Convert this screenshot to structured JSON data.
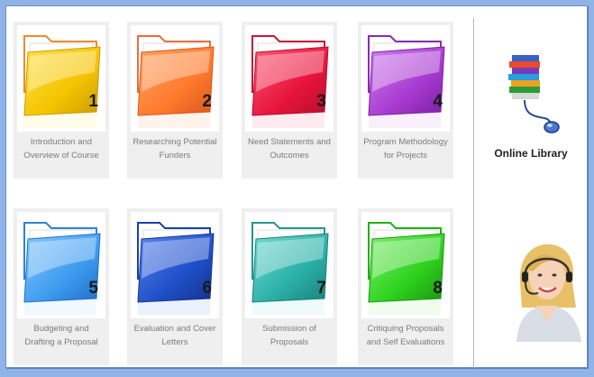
{
  "modules": [
    {
      "number": "1",
      "line1": "Introduction and",
      "line2": "Overview of Course",
      "color": "#f5c400",
      "light": "#ffe34d",
      "dark": "#c99a00",
      "tab": "#f08a2c"
    },
    {
      "number": "2",
      "line1": "Researching Potential",
      "line2": "Funders",
      "color": "#ff7a2e",
      "light": "#ffa565",
      "dark": "#d9561a",
      "tab": "#e8703a"
    },
    {
      "number": "3",
      "line1": "Need Statements and",
      "line2": "Outcomes",
      "color": "#e8143c",
      "light": "#ff5b78",
      "dark": "#b40d2c",
      "tab": "#c81838"
    },
    {
      "number": "4",
      "line1": "Program Methodology",
      "line2": "for Projects",
      "color": "#a83ad0",
      "light": "#d27ff0",
      "dark": "#7a1fa2",
      "tab": "#8a2bb4"
    },
    {
      "number": "5",
      "line1": "Budgeting and",
      "line2": "Drafting a Proposal",
      "color": "#3d9cf0",
      "light": "#8cc8ff",
      "dark": "#1f6fc4",
      "tab": "#2f82d8"
    },
    {
      "number": "6",
      "line1": "Evaluation and Cover",
      "line2": "Letters",
      "color": "#1f4fc8",
      "light": "#5a86f0",
      "dark": "#14318a",
      "tab": "#1a3fa8"
    },
    {
      "number": "7",
      "line1": "Submission of",
      "line2": "Proposals",
      "color": "#2ab0a6",
      "light": "#73dcd3",
      "dark": "#1a7f78",
      "tab": "#23968e"
    },
    {
      "number": "8",
      "line1": "Critiquing Proposals",
      "line2": "and Self Evaluations",
      "color": "#2ed21e",
      "light": "#80f06e",
      "dark": "#1a9410",
      "tab": "#22ae16"
    }
  ],
  "sidebar": {
    "library_label": "Online Library",
    "library_icon": "books-mouse-icon",
    "support_icon": "support-agent-avatar"
  }
}
